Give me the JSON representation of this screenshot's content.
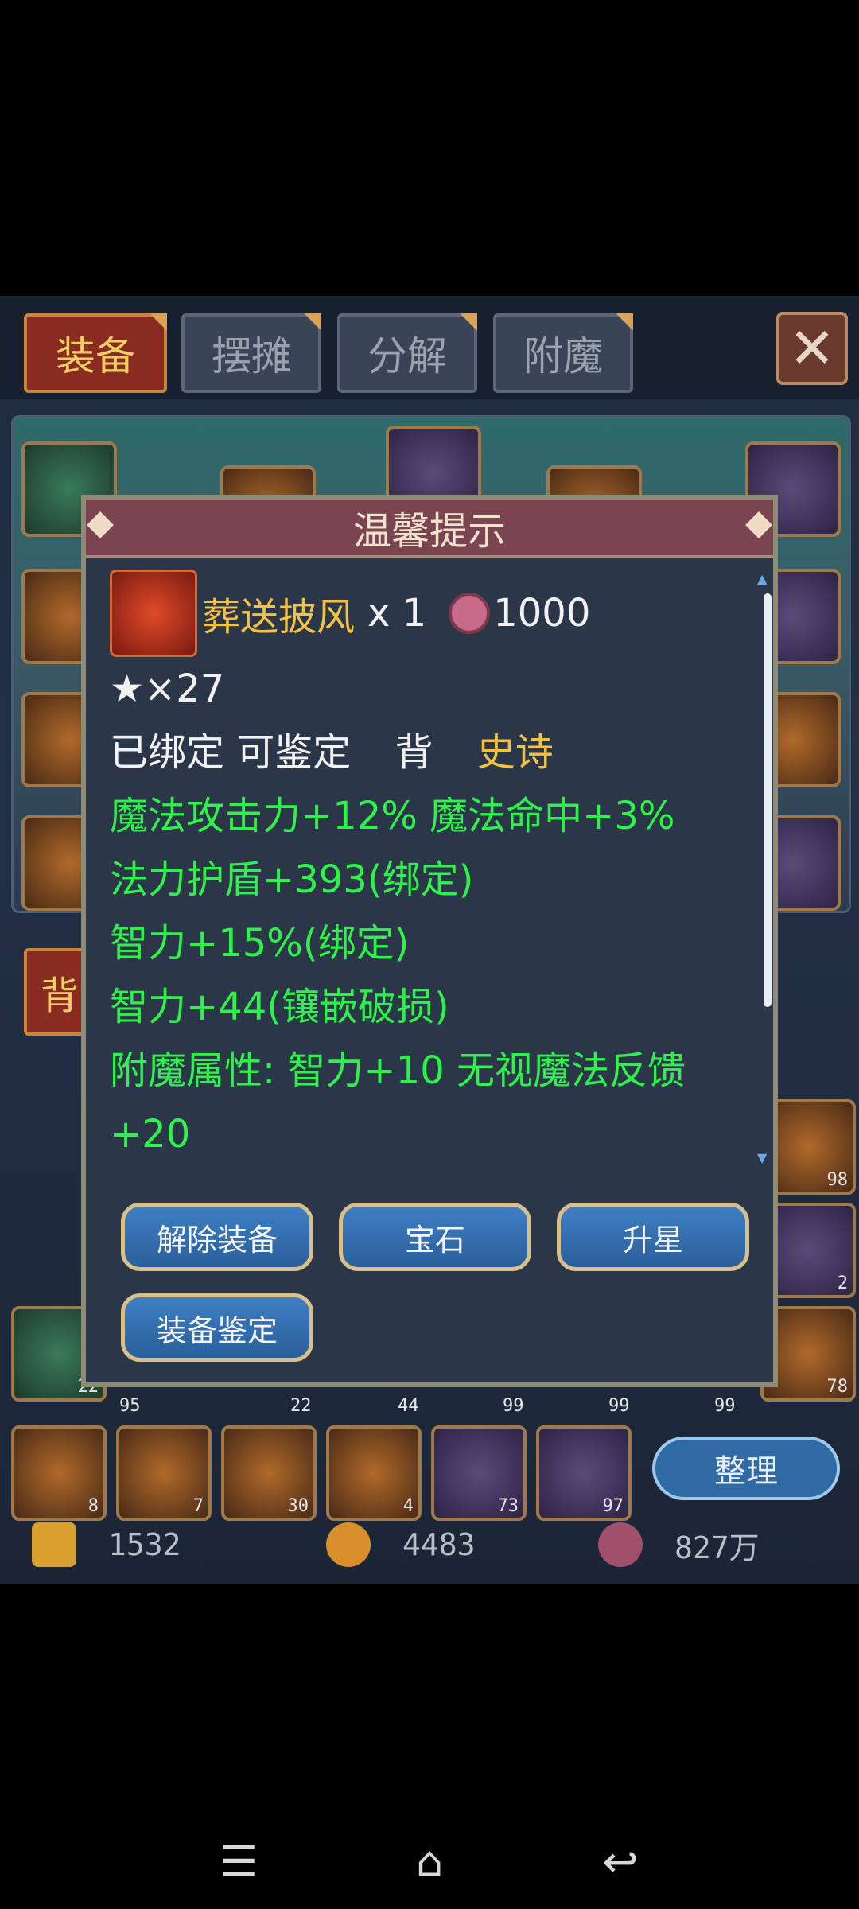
{
  "tabs": [
    {
      "label": "装备"
    },
    {
      "label": "摆摊"
    },
    {
      "label": "分解"
    },
    {
      "label": "附魔"
    }
  ],
  "backpack_tab_label": "背",
  "bag": {
    "quantities": [
      "98",
      "2",
      "22",
      "95",
      "22",
      "44",
      "99",
      "99",
      "99",
      "78",
      "8",
      "7",
      "30",
      "4",
      "73",
      "97"
    ],
    "sort_label": "整理"
  },
  "currencies": {
    "gold": "1532",
    "leaf": "4483",
    "coin": "827万"
  },
  "dialog": {
    "title": "温馨提示",
    "item_name": "葬送披风",
    "item_count": "x 1",
    "price": "1000",
    "stars": "★×27",
    "status_bound": "已绑定 可鉴定",
    "slot": "背",
    "rarity": "史诗",
    "attributes": [
      "魔法攻击力+12% 魔法命中+3%",
      "法力护盾+393(绑定)",
      "智力+15%(绑定)",
      "智力+44(镶嵌破损)",
      "附魔属性: 智力+10 无视魔法反馈",
      "+20"
    ],
    "buttons": {
      "unequip": "解除装备",
      "gem": "宝石",
      "star_up": "升星",
      "identify": "装备鉴定"
    }
  },
  "colors": {
    "attribute_green": "#2df24a",
    "rarity_gold": "#f2c245",
    "title_bar": "#7a4450"
  }
}
